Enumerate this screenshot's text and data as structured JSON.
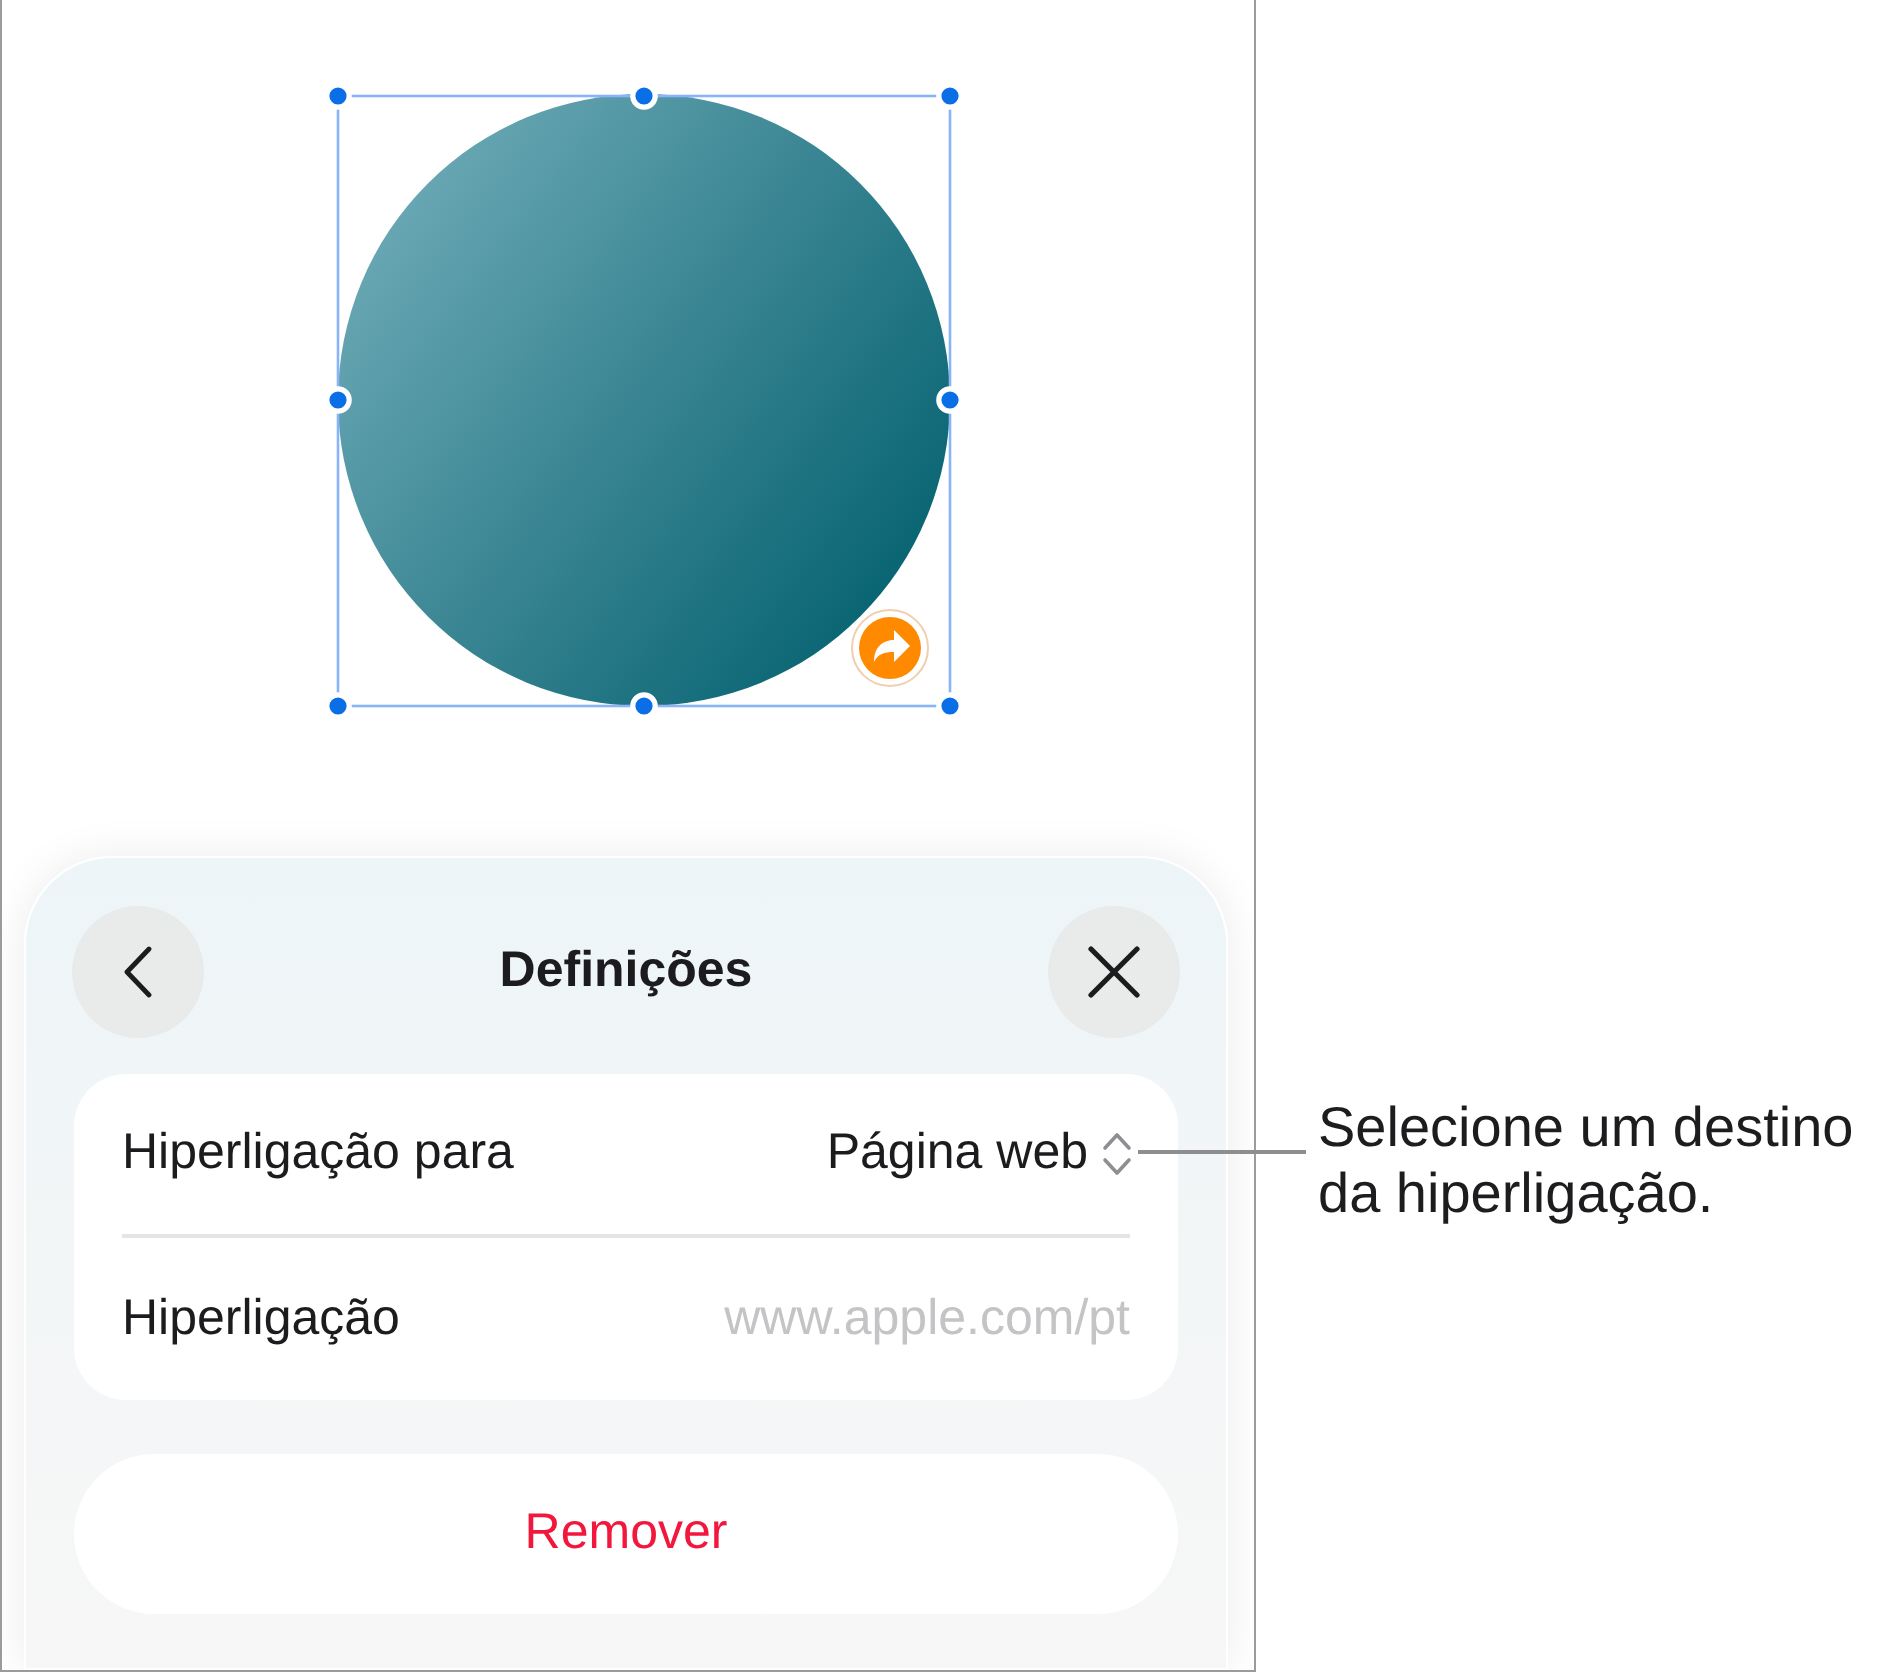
{
  "canvas": {
    "shape": {
      "kind": "circle",
      "selected": true,
      "has_link": true
    }
  },
  "sheet": {
    "title": "Definições",
    "rows": [
      {
        "kind": "popup",
        "label": "Hiperligação para",
        "value": "Página web"
      },
      {
        "kind": "field",
        "label": "Hiperligação",
        "placeholder": "www.apple.com/pt"
      }
    ],
    "remove_button": "Remover"
  },
  "callout": {
    "text": "Selecione um destino da hiperligação."
  }
}
